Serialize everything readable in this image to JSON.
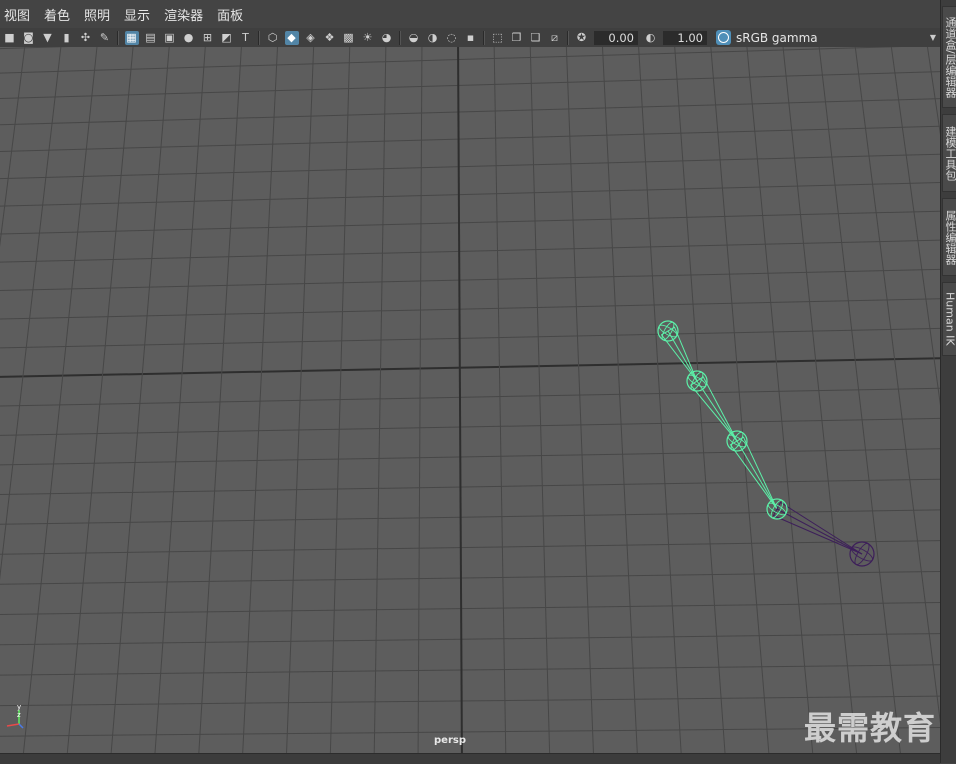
{
  "menu": {
    "items": [
      {
        "label": "视图"
      },
      {
        "label": "着色"
      },
      {
        "label": "照明"
      },
      {
        "label": "显示"
      },
      {
        "label": "渲染器"
      },
      {
        "label": "面板"
      }
    ]
  },
  "toolbar": {
    "exposure_value": "0.00",
    "gamma_value": "1.00",
    "color_space": "sRGB gamma",
    "icons": {
      "group1": [
        "camera-icon",
        "camera-attributes-icon",
        "bookmark-icon",
        "image-plane-icon",
        "2d-pan-icon",
        "grease-pencil-icon"
      ],
      "group2": [
        "grid-icon",
        "film-gate-icon",
        "resolution-gate-icon",
        "gate-mask-icon",
        "field-chart-icon",
        "safe-action-icon",
        "safe-title-icon"
      ],
      "group3": [
        "wireframe-icon",
        "smooth-shade-icon",
        "wireframe-on-shaded-icon",
        "textured-icon",
        "use-all-lights-icon",
        "shadows-icon"
      ],
      "group4": [
        "screen-space-ao-icon",
        "motion-blur-icon",
        "multisample-aa-icon",
        "depth-of-field-icon"
      ],
      "group5": [
        "isolate-select-icon",
        "xray-icon",
        "xray-active-icon",
        "xray-joints-icon",
        "backface-culling-icon"
      ]
    }
  },
  "viewport": {
    "camera_name": "persp",
    "watermark": "最需教育",
    "axis": {
      "y": "y",
      "z": "z"
    },
    "colors": {
      "background": "#5d5d5d",
      "grid": "#474747",
      "grid_axis": "#2e2e2e",
      "joint_selected": "#5cf0a8",
      "joint_unselected": "#3d1f5a"
    }
  },
  "dock": {
    "tabs": [
      {
        "label": "通道盒/层编辑器"
      },
      {
        "label": "建模工具包"
      },
      {
        "label": "属性编辑器"
      },
      {
        "label": "Human IK"
      }
    ]
  }
}
